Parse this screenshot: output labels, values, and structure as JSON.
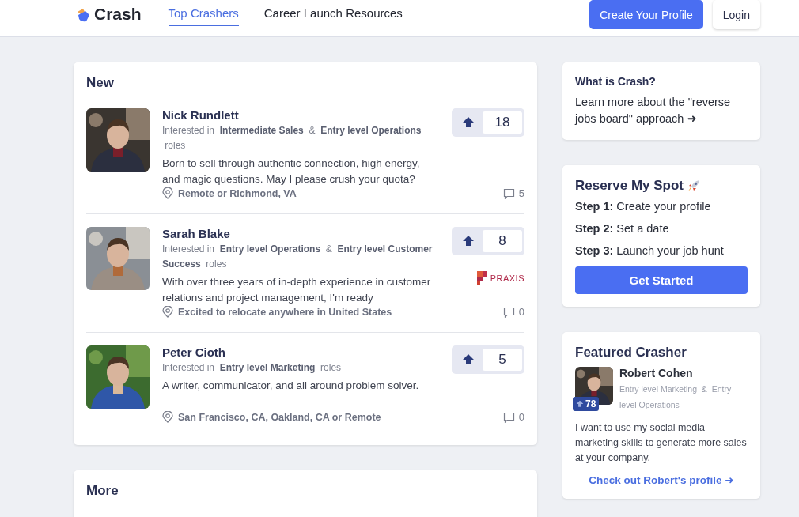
{
  "header": {
    "logo": "Crash",
    "nav": [
      {
        "label": "Top Crashers",
        "selected": true
      },
      {
        "label": "Career Launch Resources",
        "selected": false
      }
    ],
    "buttons": [
      {
        "label": "Create Your Profile",
        "kind": "primary"
      },
      {
        "label": "Login",
        "kind": "secondary"
      }
    ]
  },
  "new_section": {
    "title": "New",
    "profiles": [
      {
        "name": "Nick Rundlett",
        "interested_label": "Interested in",
        "roles": [
          "Intermediate Sales",
          "Entry level Operations"
        ],
        "joiner": "&",
        "roles_label": "roles",
        "bio": "Born to sell through authentic connection, high energy, and magic questions. May I please crush your quota?",
        "location": "Remote or Richmond, VA",
        "votes": "18",
        "comments": "5"
      },
      {
        "name": "Sarah Blake",
        "interested_label": "Interested in",
        "roles": [
          "Entry level Operations",
          "Entry level Customer Success"
        ],
        "joiner": "&",
        "roles_label": "roles",
        "bio": "With over three years of in-depth experience in customer relations and project management, I'm ready",
        "location": "Excited to relocate anywhere in United States",
        "votes": "8",
        "comments": "0",
        "partner": "PRAXIS"
      },
      {
        "name": "Peter Cioth",
        "interested_label": "Interested in",
        "roles": [
          "Entry level Marketing"
        ],
        "roles_label": "roles",
        "bio": "A writer, communicator, and all around problem solver.",
        "location": "San Francisco, CA, Oakland, CA or Remote",
        "votes": "5",
        "comments": "0"
      }
    ]
  },
  "more_section": {
    "title": "More"
  },
  "sidebar": {
    "about": {
      "title": "What is Crash?",
      "text": "Learn more about the \"reverse jobs board\" approach ➜"
    },
    "reserve": {
      "title": "Reserve My Spot",
      "steps": [
        "**Step 1:** Create your profile",
        "**Step 2:** Set a date",
        "**Step 3:** Launch your job hunt"
      ],
      "button": "Get Started"
    },
    "featured": {
      "title": "Featured Crasher",
      "name": "Robert Cohen",
      "roles": [
        "Entry level Marketing",
        "Entry level Operations"
      ],
      "joiner": "&",
      "votes": "78",
      "bio": "I want to use my social media marketing skills to generate more sales at your company.",
      "link": "Check out Robert's profile ➜"
    }
  }
}
